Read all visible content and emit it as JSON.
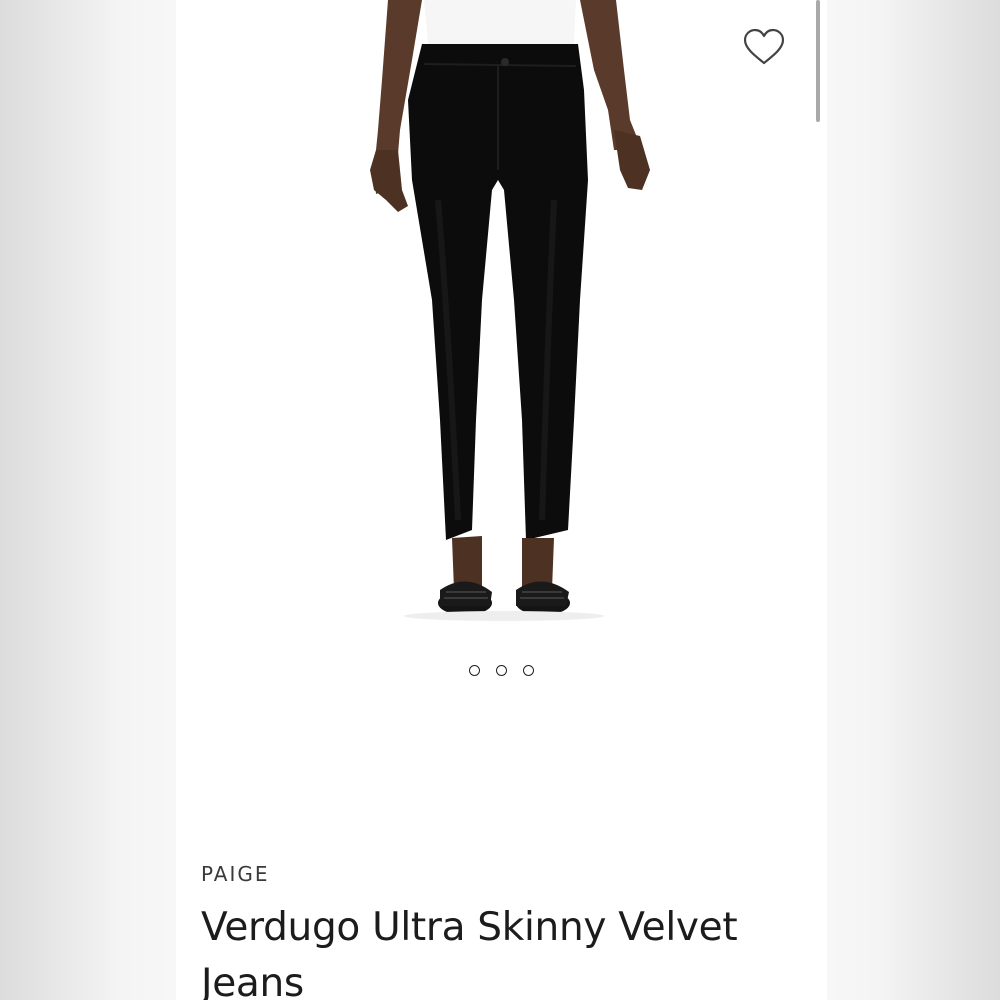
{
  "product": {
    "brand": "PAIGE",
    "title": "Verdugo Ultra Skinny Velvet Jeans",
    "image_alt": "Model wearing black velvet skinny jeans with black woven slide sandals"
  },
  "icons": {
    "favorite": "heart-outline-icon"
  },
  "carousel": {
    "dot_count": 3
  },
  "colors": {
    "text": "#1c1c1c",
    "brand_text": "#3a3a3a",
    "scrollbar": "#a9a9a9"
  }
}
